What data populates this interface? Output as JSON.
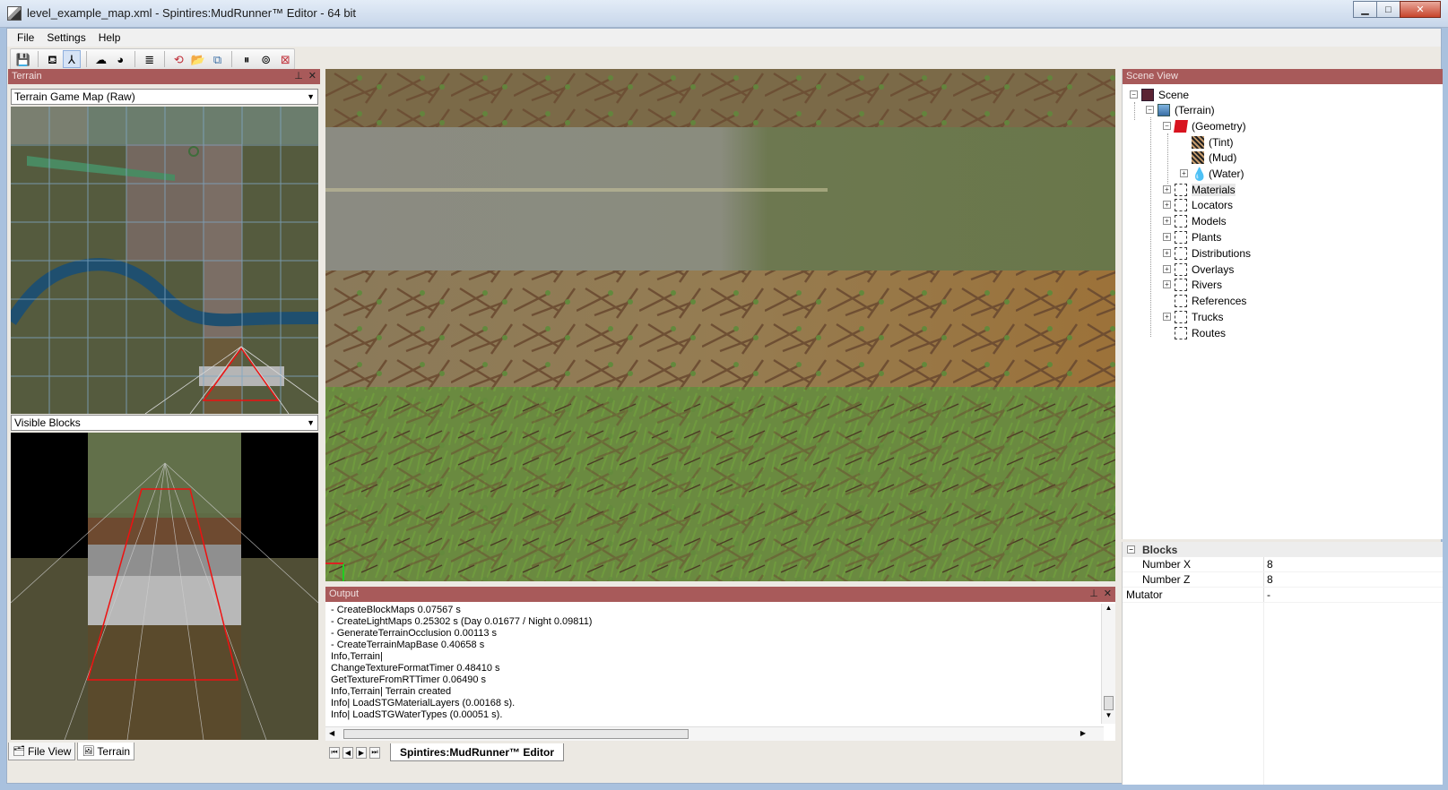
{
  "window": {
    "title": "level_example_map.xml - Spintires:MudRunner™ Editor - 64 bit",
    "minimize": "▁",
    "maximize": "□",
    "close": "✕"
  },
  "menu": [
    {
      "label": "File"
    },
    {
      "label": "Settings"
    },
    {
      "label": "Help"
    }
  ],
  "toolbar": [
    {
      "name": "save",
      "glyph": "💾"
    },
    {
      "name": "teapot",
      "glyph": "⛾"
    },
    {
      "name": "axes",
      "glyph": "⅄"
    },
    {
      "name": "weather",
      "glyph": "☁"
    },
    {
      "name": "brain",
      "glyph": "◕"
    },
    {
      "name": "text",
      "glyph": "≣"
    },
    {
      "name": "reload",
      "glyph": "⟲"
    },
    {
      "name": "folder",
      "glyph": "📂"
    },
    {
      "name": "copy",
      "glyph": "⧉"
    },
    {
      "name": "pause",
      "glyph": "⏸"
    },
    {
      "name": "zoom",
      "glyph": "⊚"
    },
    {
      "name": "stop",
      "glyph": "⊠"
    }
  ],
  "terrain_panel": {
    "title": "Terrain",
    "map_combo": "Terrain Game Map (Raw)",
    "blocks_combo": "Visible Blocks",
    "tabs": [
      "File View",
      "Terrain"
    ]
  },
  "scene_view": {
    "title": "Scene View",
    "nodes": [
      {
        "label": "Scene"
      },
      {
        "label": "(Terrain)"
      },
      {
        "label": "(Geometry)"
      },
      {
        "label": "(Tint)"
      },
      {
        "label": "(Mud)"
      },
      {
        "label": "(Water)"
      },
      {
        "label": "Materials"
      },
      {
        "label": "Locators"
      },
      {
        "label": "Models"
      },
      {
        "label": "Plants"
      },
      {
        "label": "Distributions"
      },
      {
        "label": "Overlays"
      },
      {
        "label": "Rivers"
      },
      {
        "label": "References"
      },
      {
        "label": "Trucks"
      },
      {
        "label": "Routes"
      }
    ]
  },
  "properties": {
    "group": "Blocks",
    "rows": [
      {
        "key": "Number X",
        "value": "8"
      },
      {
        "key": "Number Z",
        "value": "8"
      },
      {
        "key": "Mutator",
        "value": "-"
      }
    ]
  },
  "output": {
    "title": "Output",
    "lines": [
      " - CreateBlockMaps 0.07567 s",
      " - CreateLightMaps 0.25302 s (Day 0.01677 / Night 0.09811)",
      " - GenerateTerrainOcclusion 0.00113 s",
      " - CreateTerrainMapBase 0.40658 s",
      "Info,Terrain|",
      "ChangeTextureFormatTimer 0.48410 s",
      "GetTextureFromRTTimer 0.06490 s",
      "Info,Terrain| Terrain created",
      "Info| LoadSTGMaterialLayers (0.00168 s).",
      "Info| LoadSTGWaterTypes (0.00051 s)."
    ]
  },
  "doc_tab": "Spintires:MudRunner™ Editor"
}
